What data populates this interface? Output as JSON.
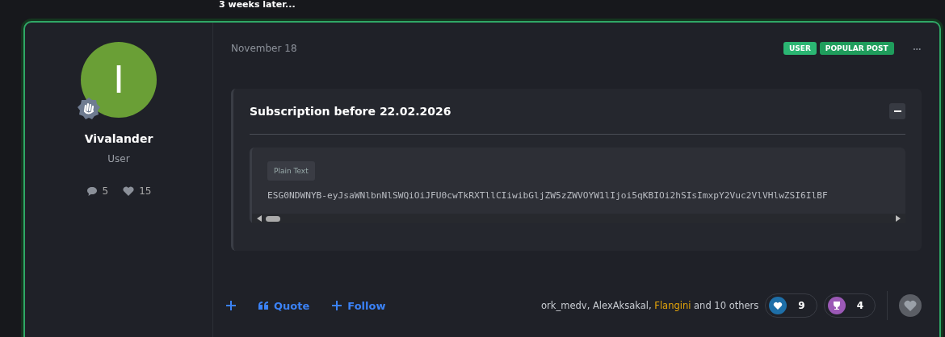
{
  "separator": "3 weeks later...",
  "author": {
    "initial": "I",
    "name": "Vivalander",
    "role": "User",
    "posts": "5",
    "likes": "15"
  },
  "post": {
    "date": "November 18",
    "badges": [
      {
        "label": "USER",
        "color": "#2bb673"
      },
      {
        "label": "POPULAR POST",
        "color": "#1f9d5c"
      }
    ],
    "more": "•••",
    "spoiler": {
      "title": "Subscription before 22.02.2026",
      "expanded": true,
      "code_language": "Plain Text",
      "code": "ESG0NDWNYB-eyJsaWNlbnNlSWQiOiJFU0cwTkRXTllCIiwibGljZW5zZWVOYW1lIjoi5qKBIOi2hSIsImxpY2Vuc2VlVHlwZSI6IlBF"
    }
  },
  "actions": [
    {
      "kind": "plus"
    },
    {
      "kind": "quote",
      "label": "Quote"
    },
    {
      "kind": "plus",
      "label": "Follow"
    }
  ],
  "reacted_by": {
    "users": [
      {
        "text": "ork_medv,",
        "highlighted": false
      },
      {
        "text": "AlexAksakal,",
        "highlighted": false
      },
      {
        "text": "Flangini",
        "highlighted": true
      }
    ],
    "others": "and 10 others"
  },
  "reactions": [
    {
      "kind": "heart",
      "count": "9"
    },
    {
      "kind": "trophy",
      "count": "4"
    }
  ]
}
